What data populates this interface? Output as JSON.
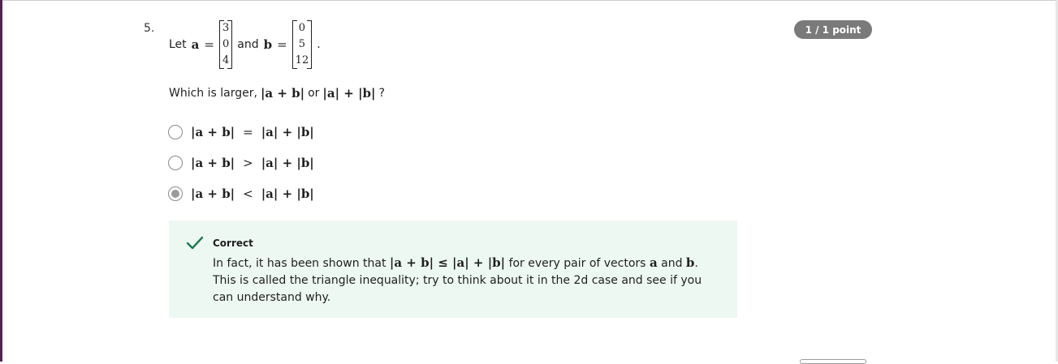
{
  "question": {
    "number": "5.",
    "points": "1 / 1 point",
    "stem": {
      "let": "Let",
      "a_symbol": "a",
      "equals": "=",
      "vector_a": [
        "3",
        "0",
        "4"
      ],
      "and": "and",
      "b_symbol": "b",
      "vector_b": [
        "0",
        "5",
        "12"
      ],
      "period": "."
    },
    "prompt": {
      "text": "Which is larger,",
      "expr1": "|a + b|",
      "or": "or",
      "expr2": "|a| + |b|",
      "qmark": "?"
    }
  },
  "options": [
    {
      "label_left": "|a + b|",
      "relation": "=",
      "label_right": "|a| + |b|",
      "selected": false
    },
    {
      "label_left": "|a + b|",
      "relation": ">",
      "label_right": "|a| + |b|",
      "selected": false
    },
    {
      "label_left": "|a + b|",
      "relation": "<",
      "label_right": "|a| + |b|",
      "selected": true
    }
  ],
  "feedback": {
    "status": "Correct",
    "intro": "In fact, it has been shown that",
    "ineq": "|a + b| ≤ |a| + |b|",
    "mid": "for every pair of vectors",
    "a": "a",
    "and": "and",
    "b": "b",
    "rest": ". This is called the triangle inequality; try to think about it in the 2d case and see if you can understand why.",
    "colors": {
      "background": "#eef8f3",
      "check": "#1e7a4f"
    },
    "icon": "checkmark-icon"
  },
  "colors": {
    "accent": "#5b1f56",
    "badge": "#7a7a7a"
  }
}
